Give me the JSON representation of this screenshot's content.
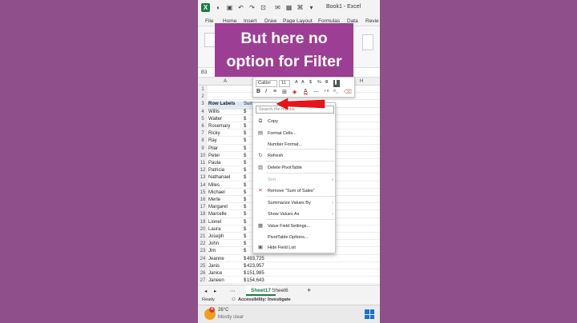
{
  "window": {
    "title": "Book1 - Excel",
    "save_icon": "save-icon",
    "undo_icon": "undo-icon",
    "redo_icon": "redo-icon"
  },
  "menu": {
    "items": [
      "File",
      "Home",
      "Insert",
      "Draw",
      "Page Layout",
      "Formulas",
      "Data",
      "Revie"
    ]
  },
  "overlay": {
    "line1": "But here no",
    "line2": "option for Filter"
  },
  "namebox": {
    "value": "B3"
  },
  "columns": [
    "A",
    "B",
    "C",
    "D",
    "E",
    "F",
    "G",
    "H"
  ],
  "mini_toolbar": {
    "font": "Calibri",
    "size": "11",
    "currency": "$",
    "percent": "%",
    "comma": "9"
  },
  "rows": [
    {
      "n": "1",
      "a": "",
      "b": ""
    },
    {
      "n": "2",
      "a": "",
      "b": ""
    },
    {
      "n": "3",
      "a": "Row Labels",
      "b": "Sum"
    },
    {
      "n": "4",
      "a": "Willis",
      "b": "$"
    },
    {
      "n": "5",
      "a": "Walter",
      "b": "$"
    },
    {
      "n": "6",
      "a": "Rosemary",
      "b": "$"
    },
    {
      "n": "7",
      "a": "Ricky",
      "b": "$"
    },
    {
      "n": "8",
      "a": "Ray",
      "b": "$"
    },
    {
      "n": "9",
      "a": "Pilar",
      "b": "$"
    },
    {
      "n": "10",
      "a": "Peter",
      "b": "$"
    },
    {
      "n": "11",
      "a": "Paula",
      "b": "$"
    },
    {
      "n": "12",
      "a": "Patricia",
      "b": "$"
    },
    {
      "n": "13",
      "a": "Nathanael",
      "b": "$"
    },
    {
      "n": "14",
      "a": "Miles",
      "b": "$"
    },
    {
      "n": "15",
      "a": "Michael",
      "b": "$"
    },
    {
      "n": "16",
      "a": "Merle",
      "b": "$"
    },
    {
      "n": "17",
      "a": "Margaret",
      "b": "$"
    },
    {
      "n": "18",
      "a": "Marcelle",
      "b": "$"
    },
    {
      "n": "19",
      "a": "Lionel",
      "b": "$"
    },
    {
      "n": "20",
      "a": "Laura",
      "b": "$"
    },
    {
      "n": "21",
      "a": "Joseph",
      "b": "$"
    },
    {
      "n": "22",
      "a": "John",
      "b": "$"
    },
    {
      "n": "23",
      "a": "Jim",
      "b": "$"
    },
    {
      "n": "24",
      "a": "Jeanne",
      "b": "$",
      "v": "493,725"
    },
    {
      "n": "25",
      "a": "Janis",
      "b": "$",
      "v": "423,957"
    },
    {
      "n": "26",
      "a": "Janice",
      "b": "$",
      "v": "151,985"
    },
    {
      "n": "27",
      "a": "Janeen",
      "b": "$",
      "v": "154,643"
    }
  ],
  "context_menu": {
    "search_placeholder": "Search the menus",
    "items": [
      {
        "icon": "copy-icon",
        "label": "Copy",
        "disabled": false
      },
      {
        "icon": "format-cells-icon",
        "label": "Format Cells...",
        "disabled": false
      },
      {
        "icon": "",
        "label": "Number Format...",
        "disabled": false
      },
      {
        "icon": "refresh-icon",
        "label": "Refresh",
        "disabled": false
      },
      {
        "icon": "delete-pivot-icon",
        "label": "Delete PivotTable",
        "disabled": false
      },
      {
        "icon": "",
        "label": "Sort",
        "disabled": true,
        "submenu": true
      },
      {
        "icon": "remove-icon",
        "label": "Remove \"Sum of Sales\"",
        "disabled": false
      },
      {
        "icon": "",
        "label": "Summarize Values By",
        "disabled": false,
        "submenu": true
      },
      {
        "icon": "",
        "label": "Show Values As",
        "disabled": false,
        "submenu": true
      },
      {
        "icon": "value-field-settings-icon",
        "label": "Value Field Settings...",
        "disabled": false
      },
      {
        "icon": "",
        "label": "PivotTable Options...",
        "disabled": false
      },
      {
        "icon": "hide-field-list-icon",
        "label": "Hide Field List",
        "disabled": false
      }
    ]
  },
  "sheets": {
    "active": "Sheet17",
    "other": "Sheet6",
    "add": "+"
  },
  "status": {
    "ready": "Ready",
    "accessibility": "Accessibility: Investigate"
  },
  "taskbar": {
    "temp": "26°C",
    "weather": "Mostly clear",
    "badge": "4"
  },
  "colors": {
    "excel_green": "#1e7a45",
    "overlay_purple": "#9c3f94",
    "arrow_red": "#e8141b",
    "background": "#8f4f8a"
  }
}
